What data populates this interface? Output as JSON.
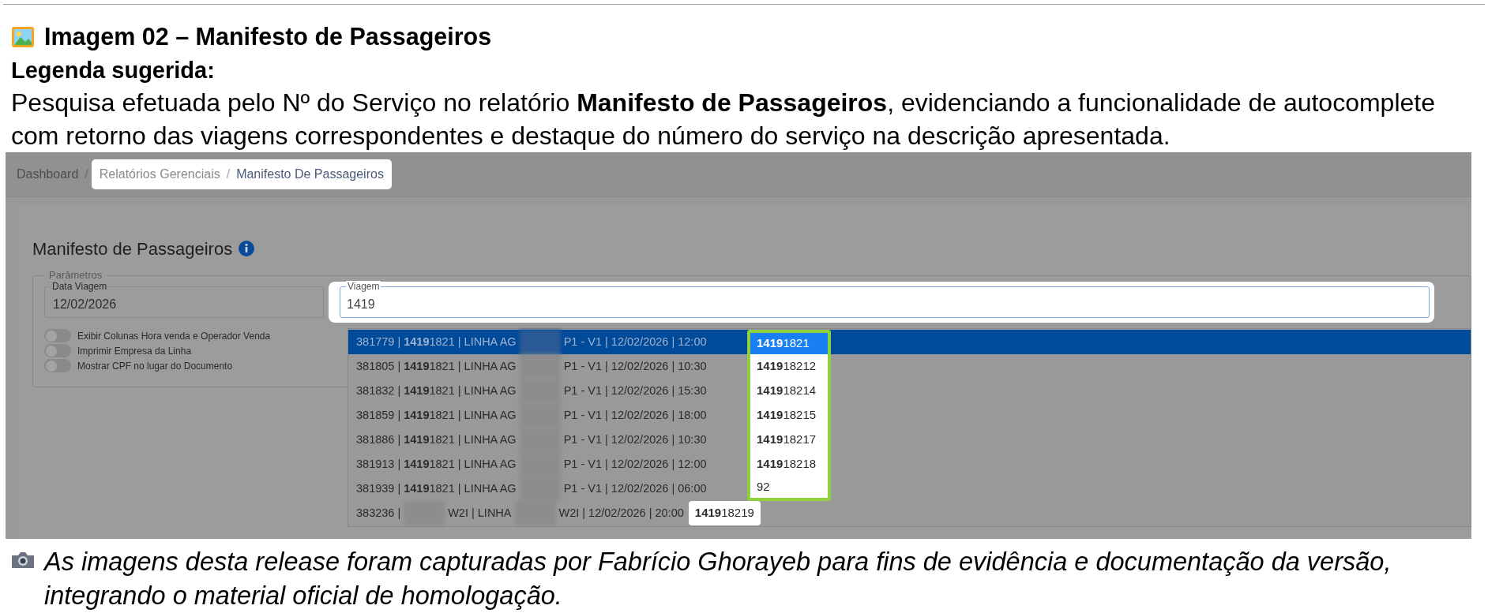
{
  "document": {
    "title": "Imagem 02 – Manifesto de Passageiros",
    "legend_label": "Legenda sugerida:",
    "description": "Pesquisa efetuada pelo Nº do Serviço no relatório **Manifesto de Passageiros**, evidenciando a funcionalidade de autocomplete com retorno das viagens correspondentes e destaque do número do serviço na descrição apresentada.",
    "caption": "As imagens desta release foram capturadas por Fabrício Ghorayeb para fins de evidência e documentação da versão, integrando o material oficial de homologação."
  },
  "screenshot": {
    "breadcrumb": [
      {
        "label": "Dashboard",
        "separator": "/",
        "highlighted": false
      },
      {
        "label": "Relatórios Gerenciais",
        "separator": "/",
        "highlighted": true
      },
      {
        "label": "Manifesto De Passageiros",
        "highlighted": true
      }
    ],
    "page_title": "Manifesto de Passageiros",
    "fieldset_legend": "Parâmetros",
    "fields": [
      {
        "label": "Data Viagem",
        "value": "12/02/2026",
        "highlighted": false
      },
      {
        "label": "Viagem",
        "value": "1419",
        "highlighted": true
      }
    ],
    "toggles": [
      {
        "label": "Exibir Colunas Hora venda e Operador Venda",
        "on": false
      },
      {
        "label": "Imprimir Empresa da Linha",
        "on": false
      },
      {
        "label": "Mostrar CPF no lugar do Documento",
        "on": false
      }
    ],
    "suggestions": [
      {
        "selected": true,
        "boxed": true,
        "parts": [
          {
            "kind": "text",
            "text": "381779 | **1419**1821 | LINHA AG"
          },
          {
            "kind": "redacted"
          },
          {
            "kind": "text",
            "text": "P1 - V1 | 12/02/2026 | 12:00"
          }
        ],
        "code": "**1419**1821"
      },
      {
        "selected": false,
        "boxed": true,
        "parts": [
          {
            "kind": "text",
            "text": "381805 | **1419**1821 | LINHA AG"
          },
          {
            "kind": "redacted"
          },
          {
            "kind": "text",
            "text": "P1 - V1 | 12/02/2026 | 10:30"
          }
        ],
        "code": "**1419**18212"
      },
      {
        "selected": false,
        "boxed": true,
        "parts": [
          {
            "kind": "text",
            "text": "381832 | **1419**1821 | LINHA AG"
          },
          {
            "kind": "redacted"
          },
          {
            "kind": "text",
            "text": "P1 - V1 | 12/02/2026 | 15:30"
          }
        ],
        "code": "**1419**18214"
      },
      {
        "selected": false,
        "boxed": true,
        "parts": [
          {
            "kind": "text",
            "text": "381859 | **1419**1821 | LINHA AG"
          },
          {
            "kind": "redacted"
          },
          {
            "kind": "text",
            "text": "P1 - V1 | 12/02/2026 | 18:00"
          }
        ],
        "code": "**1419**18215"
      },
      {
        "selected": false,
        "boxed": true,
        "parts": [
          {
            "kind": "text",
            "text": "381886 | **1419**1821 | LINHA AG"
          },
          {
            "kind": "redacted"
          },
          {
            "kind": "text",
            "text": "P1 - V1 | 12/02/2026 | 10:30"
          }
        ],
        "code": "**1419**18217"
      },
      {
        "selected": false,
        "boxed": true,
        "parts": [
          {
            "kind": "text",
            "text": "381913 | **1419**1821 | LINHA AG"
          },
          {
            "kind": "redacted"
          },
          {
            "kind": "text",
            "text": "P1 - V1 | 12/02/2026 | 12:00"
          }
        ],
        "code": "**1419**18218"
      },
      {
        "selected": false,
        "boxed": true,
        "parts": [
          {
            "kind": "text",
            "text": "381939 | **1419**1821 | LINHA AG"
          },
          {
            "kind": "redacted"
          },
          {
            "kind": "text",
            "text": "P1 - V1 | 12/02/2026 | 06:00"
          }
        ],
        "code": "92"
      },
      {
        "selected": false,
        "boxed": false,
        "parts": [
          {
            "kind": "text",
            "text": "383236 |"
          },
          {
            "kind": "redacted"
          },
          {
            "kind": "text",
            "text": "W2I | LINHA"
          },
          {
            "kind": "redacted"
          },
          {
            "kind": "text",
            "text": "W2I | 12/02/2026 | 20:00"
          }
        ],
        "code": "**1419**18219"
      }
    ]
  }
}
